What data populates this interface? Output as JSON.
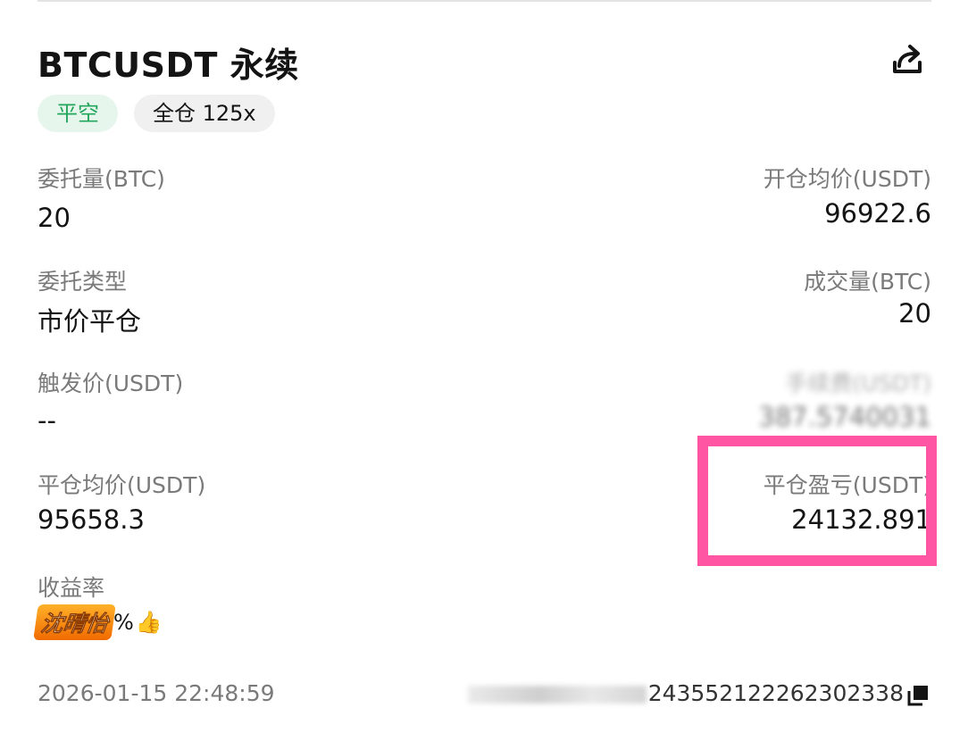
{
  "header": {
    "title": "BTCUSDT 永续",
    "share_icon": "share-icon"
  },
  "tags": {
    "side": "平空",
    "margin": "全仓 125x"
  },
  "fields": {
    "order_qty_label": "委托量(BTC)",
    "order_qty_value": "20",
    "open_avg_label": "开仓均价(USDT)",
    "open_avg_value": "96922.6",
    "order_type_label": "委托类型",
    "order_type_value": "市价平仓",
    "filled_qty_label": "成交量(BTC)",
    "filled_qty_value": "20",
    "trigger_label": "触发价(USDT)",
    "trigger_value": "--",
    "obscured_label": "手续费(USDT)",
    "obscured_value": "387.5740031",
    "close_avg_label": "平仓均价(USDT)",
    "close_avg_value": "95658.3",
    "close_pnl_label": "平仓盈亏(USDT)",
    "close_pnl_value": "24132.891",
    "roi_label": "收益率",
    "roi_value": "%"
  },
  "sticker": {
    "text": "沈晴怡",
    "icon": "thumbs-up-icon"
  },
  "footer": {
    "timestamp": "2026-01-15 22:48:59",
    "order_id": "243552122262302338",
    "copy_icon": "copy-icon"
  },
  "colors": {
    "long_short_green": "#23a55c",
    "highlight_pink": "#ff55a3",
    "label_gray": "#7a7a7a"
  }
}
